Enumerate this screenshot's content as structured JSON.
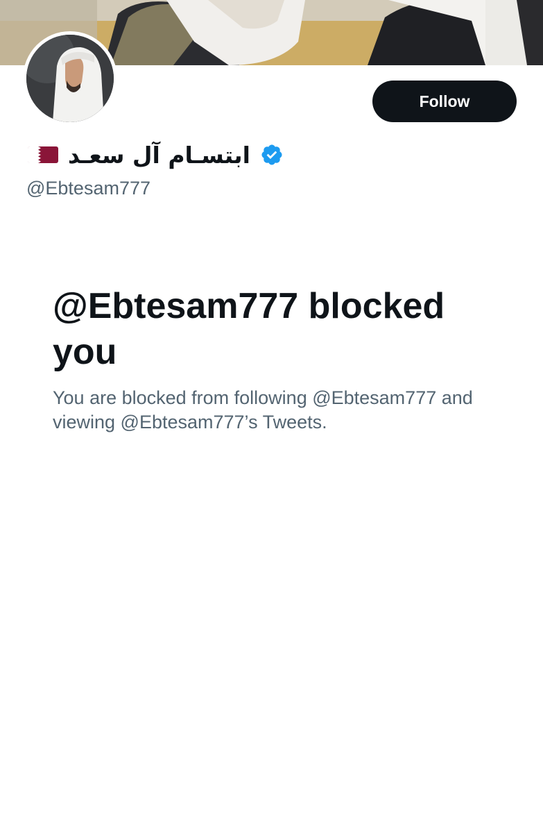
{
  "profile": {
    "display_name": "ابتسـام آل سعـد",
    "handle": "@Ebtesam777",
    "flag_icon": "qatar-flag-icon",
    "verified_icon": "verified-badge-icon",
    "follow_label": "Follow"
  },
  "blocked": {
    "title": "@Ebtesam777 blocked you",
    "description": "You are blocked from following @Ebtesam777 and viewing @Ebtesam777’s Tweets."
  },
  "colors": {
    "follow_bg": "#0f1419",
    "verified": "#1d9bf0",
    "secondary_text": "#536471",
    "flag_maroon": "#8a1538"
  }
}
